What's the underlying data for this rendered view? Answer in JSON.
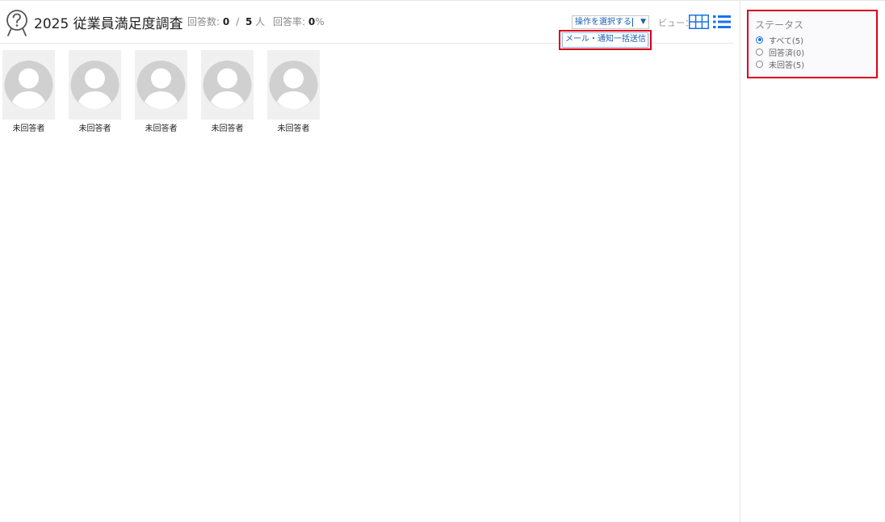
{
  "header": {
    "title": "2025 従業員満足度調査",
    "stats": {
      "answered_label": "回答数:",
      "answered_count": "0",
      "separator": "/",
      "total_count": "5",
      "total_unit": "人",
      "rate_label": "回答率:",
      "rate_value": "0",
      "rate_unit": "%"
    },
    "operation_select": {
      "value": "操作を選択する",
      "arrow": "▼",
      "options": [
        "メール・通知一括送信"
      ]
    },
    "view": {
      "label": "ビュー：",
      "modes": [
        "grid-view-icon",
        "list-view-icon"
      ],
      "active_color": "#1a73e8"
    }
  },
  "respondents": [
    {
      "status": "未回答者"
    },
    {
      "status": "未回答者"
    },
    {
      "status": "未回答者"
    },
    {
      "status": "未回答者"
    },
    {
      "status": "未回答者"
    }
  ],
  "sidebar": {
    "status_filter": {
      "title": "ステータス",
      "options": [
        {
          "label": "すべて(5)",
          "checked": true
        },
        {
          "label": "回答済(0)",
          "checked": false
        },
        {
          "label": "未回答(5)",
          "checked": false
        }
      ]
    }
  },
  "colors": {
    "highlight": "#d9001b",
    "link": "#1a5fb4",
    "accent": "#1a73e8",
    "placeholder": "#d0d0d0"
  }
}
